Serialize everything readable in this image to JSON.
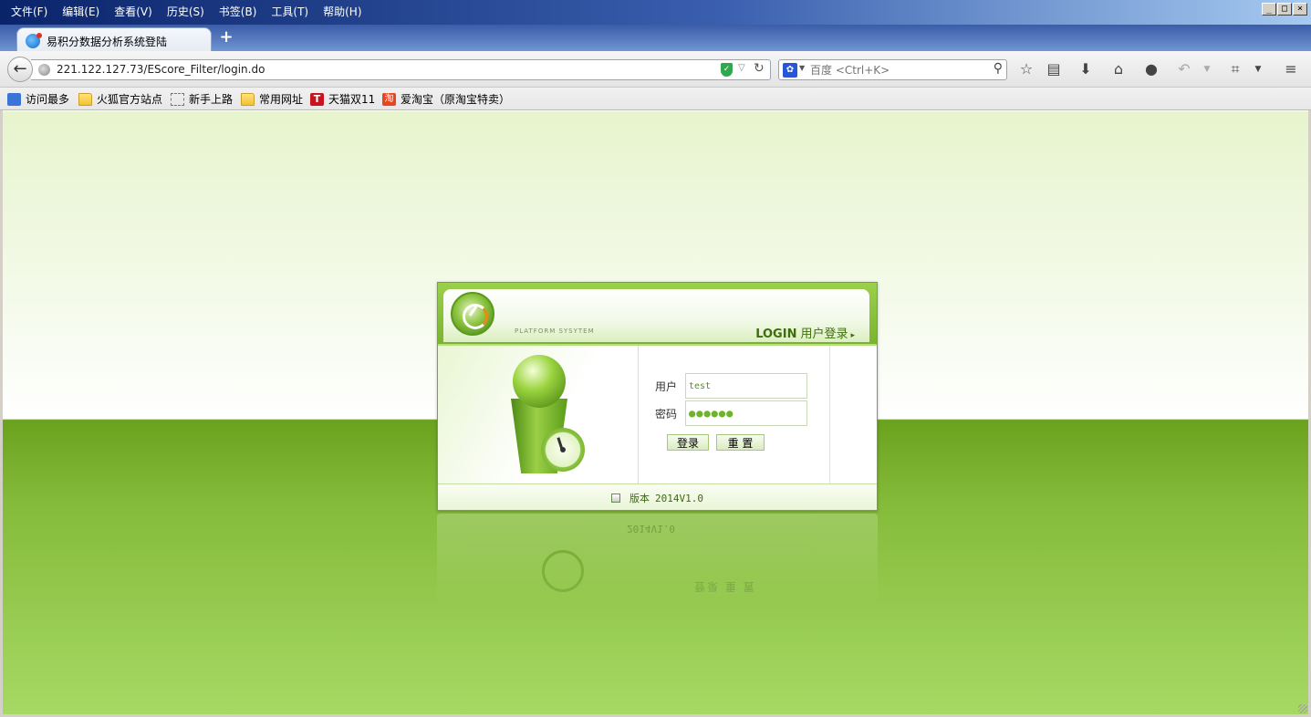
{
  "menubar": {
    "items": [
      "文件(F)",
      "编辑(E)",
      "查看(V)",
      "历史(S)",
      "书签(B)",
      "工具(T)",
      "帮助(H)"
    ]
  },
  "window_controls": {
    "minimize": "_",
    "maximize": "□",
    "close": "×"
  },
  "tab": {
    "title": "易积分数据分析系统登陆",
    "new_tab": "+"
  },
  "navbar": {
    "back_icon": "←",
    "url": "221.122.127.73/EScore_Filter/login.do",
    "search_engine_icon": "baidu-paw-icon",
    "search_placeholder": "百度 <Ctrl+K>",
    "toolbar_icons": [
      "star-icon",
      "reading-list-icon",
      "download-icon",
      "home-icon",
      "chat-icon",
      "undo-icon",
      "screenshot-icon",
      "menu-icon"
    ]
  },
  "bookmarks": [
    {
      "label": "访问最多",
      "icon": "most-visited-icon"
    },
    {
      "label": "火狐官方站点",
      "icon": "folder-icon"
    },
    {
      "label": "新手上路",
      "icon": "dashed-page-icon"
    },
    {
      "label": "常用网址",
      "icon": "folder-icon"
    },
    {
      "label": "天猫双11",
      "icon": "tmall-icon",
      "glyph": "T"
    },
    {
      "label": "爱淘宝（原淘宝特卖）",
      "icon": "taobao-icon",
      "glyph": "淘"
    }
  ],
  "login": {
    "platform_text": "PLATFORM SYSYTEM",
    "login_en": "LOGIN",
    "login_cn": "用户登录",
    "login_arrow": "▸",
    "username_label": "用户",
    "username_value": "test",
    "password_label": "密码",
    "password_value": "●●●●●●",
    "submit_label": "登录",
    "reset_label": "重 置",
    "version_label": "版本",
    "version_value": "2014V1.0"
  },
  "colors": {
    "accent_green": "#78b52c",
    "dark_green": "#3d6e0c",
    "title_bar_start": "#0a246a",
    "title_bar_end": "#a6caf0"
  }
}
